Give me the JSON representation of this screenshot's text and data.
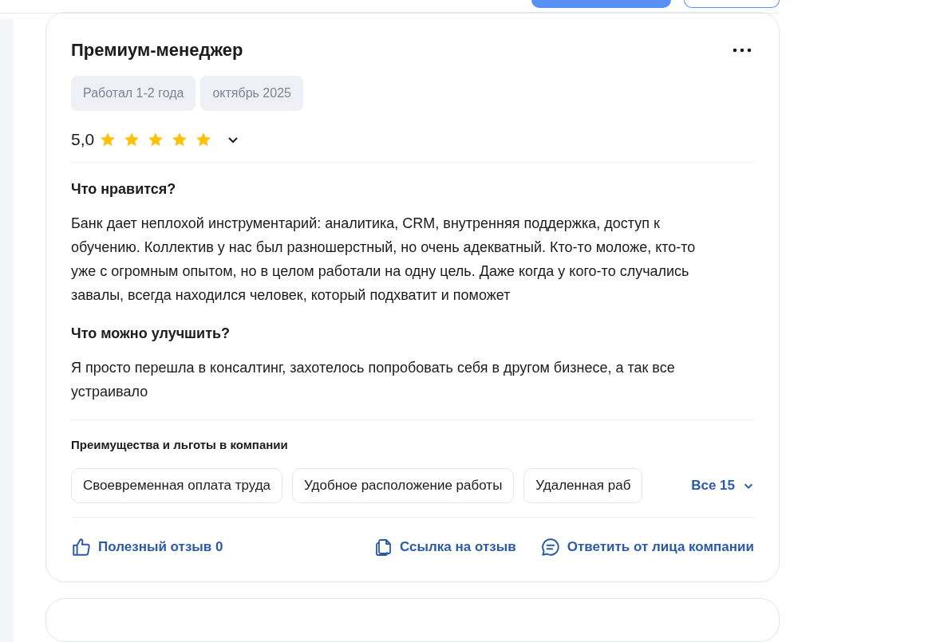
{
  "review": {
    "title": "Премиум-менеджер",
    "tags": [
      "Работал 1-2 года",
      "октябрь 2025"
    ],
    "rating": {
      "value": "5,0",
      "stars": 5,
      "expanded": false
    },
    "sections": [
      {
        "heading": "Что нравится?",
        "text": "Банк дает неплохой инструментарий: аналитика, CRM, внутренняя поддержка, доступ к обучению. Коллектив у нас был разношерстный, но очень адекватный. Кто-то моложе, кто-то уже с огромным опытом, но в целом работали на одну цель. Даже когда у кого-то случались завалы, всегда находился человек, который подхватит и поможет"
      },
      {
        "heading": "Что можно улучшить?",
        "text": "Я просто перешла в консалтинг, захотелось попробовать себя в другом бизнесе, а так все устраивало"
      }
    ],
    "benefits": {
      "heading": "Преимущества и льготы в компании",
      "items": [
        "Своевременная оплата труда",
        "Удобное расположение работы",
        "Удаленная раб"
      ],
      "more": "Все 15"
    },
    "actions": [
      {
        "kind": "like",
        "label": "Полезный отзыв 0"
      },
      {
        "kind": "link",
        "label": "Ссылка на отзыв"
      },
      {
        "kind": "reply",
        "label": "Ответить от лица компании"
      }
    ]
  }
}
